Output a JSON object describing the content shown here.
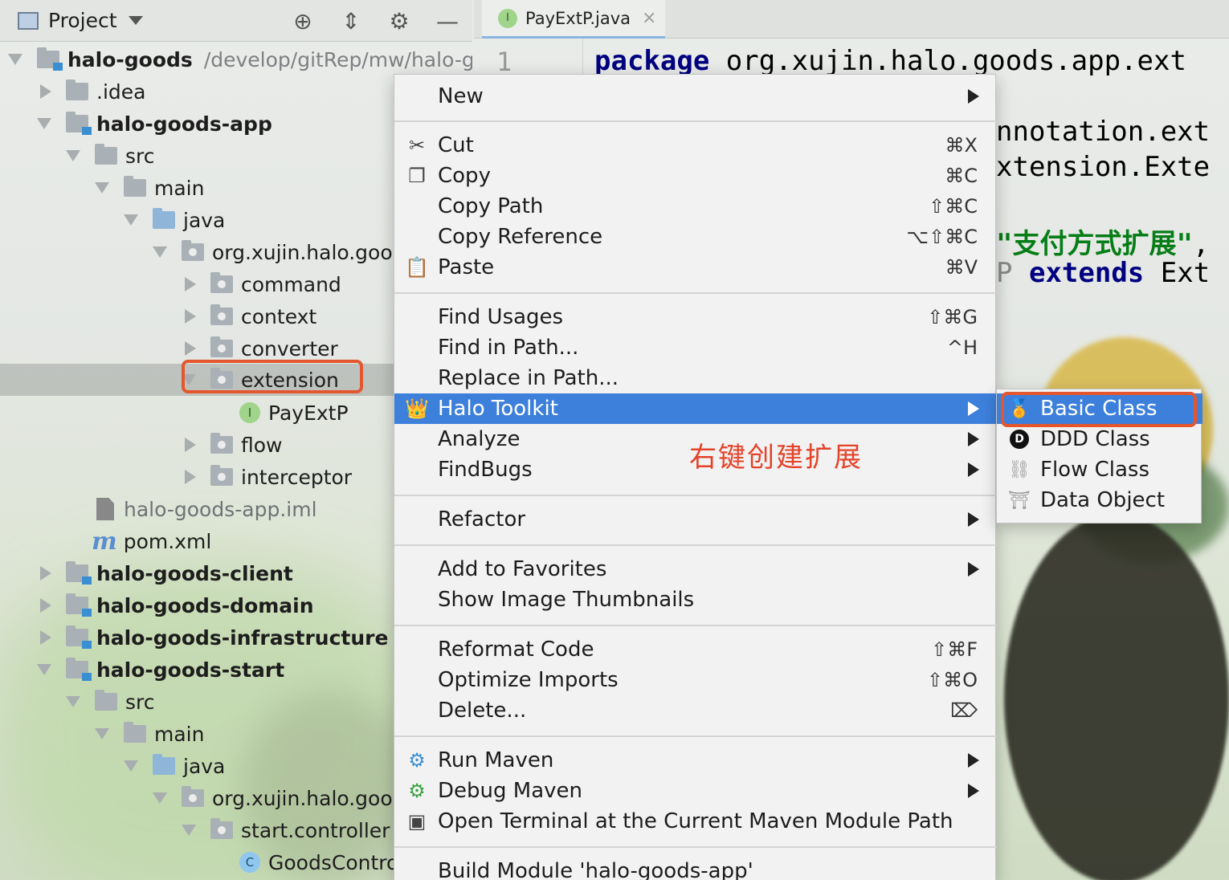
{
  "project_panel": {
    "title": "Project",
    "tree": [
      {
        "label": "halo-goods",
        "path": "/develop/gitRep/mw/halo-goo"
      },
      {
        "label": ".idea"
      },
      {
        "label": "halo-goods-app"
      },
      {
        "label": "src"
      },
      {
        "label": "main"
      },
      {
        "label": "java"
      },
      {
        "label": "org.xujin.halo.gooc"
      },
      {
        "label": "command"
      },
      {
        "label": "context"
      },
      {
        "label": "converter"
      },
      {
        "label": "extension"
      },
      {
        "label": "PayExtP",
        "icon_letter": "I"
      },
      {
        "label": "flow"
      },
      {
        "label": "interceptor"
      },
      {
        "label": "halo-goods-app.iml"
      },
      {
        "label": "pom.xml",
        "icon_letter": "m"
      },
      {
        "label": "halo-goods-client"
      },
      {
        "label": "halo-goods-domain"
      },
      {
        "label": "halo-goods-infrastructure"
      },
      {
        "label": "halo-goods-start"
      },
      {
        "label": "src"
      },
      {
        "label": "main"
      },
      {
        "label": "java"
      },
      {
        "label": "org.xujin.halo.gooc"
      },
      {
        "label": "start.controller"
      },
      {
        "label": "GoodsContro",
        "icon_letter": "C"
      }
    ]
  },
  "editor": {
    "tab_label": "PayExtP.java",
    "tab_icon_letter": "I",
    "line_number": "1",
    "code": {
      "line1_kw": "package",
      "line1_rest": "org.xujin.halo.goods.app.ext",
      "line2": "nnotation.ext",
      "line3": "xtension.Exte",
      "line4_str": "\"支付方式扩展\"",
      "line4_rest": ",",
      "line5_pre": "P",
      "line5_kw": "extends",
      "line5_rest": "Ext"
    }
  },
  "context_menu": {
    "new": "New",
    "cut": "Cut",
    "cut_sc": "⌘X",
    "copy": "Copy",
    "copy_sc": "⌘C",
    "copy_path": "Copy Path",
    "copy_path_sc": "⇧⌘C",
    "copy_reference": "Copy Reference",
    "copy_reference_sc": "⌥⇧⌘C",
    "paste": "Paste",
    "paste_sc": "⌘V",
    "find_usages": "Find Usages",
    "find_usages_sc": "⇧⌘G",
    "find_in_path": "Find in Path...",
    "find_in_path_sc": "^H",
    "replace_in_path": "Replace in Path...",
    "halo_toolkit": "Halo Toolkit",
    "analyze": "Analyze",
    "findbugs": "FindBugs",
    "refactor": "Refactor",
    "add_to_favorites": "Add to Favorites",
    "show_image_thumbnails": "Show Image Thumbnails",
    "reformat_code": "Reformat Code",
    "reformat_code_sc": "⇧⌘F",
    "optimize_imports": "Optimize Imports",
    "optimize_imports_sc": "⇧⌘O",
    "delete": "Delete...",
    "delete_sc": "⌦",
    "run_maven": "Run Maven",
    "debug_maven": "Debug Maven",
    "open_terminal": "Open Terminal at the Current Maven Module Path",
    "build_module": "Build Module 'halo-goods-app'",
    "annotation": "右键创建扩展"
  },
  "submenu": {
    "basic_class": "Basic Class",
    "ddd_class": "DDD Class",
    "ddd_icon_letter": "D",
    "flow_class": "Flow Class",
    "data_object": "Data Object"
  },
  "colors": {
    "highlight": "#3d80dc",
    "annotation_red": "#e4432a"
  }
}
